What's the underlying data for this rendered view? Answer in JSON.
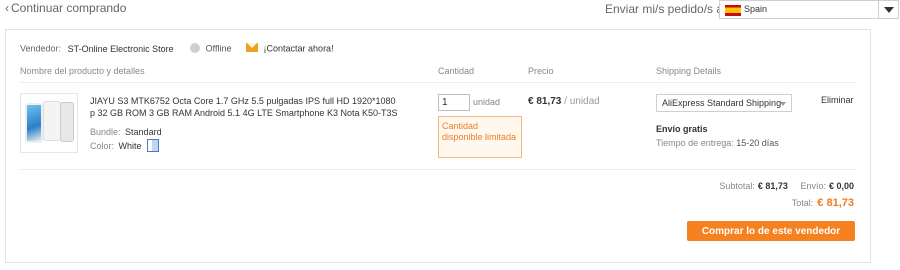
{
  "header": {
    "continue_chevron": "‹",
    "continue_label": "Continuar comprando",
    "ship_to_label": "Enviar mi/s pedido/s a:",
    "country_flag": "ES",
    "country": "Spain"
  },
  "seller": {
    "label": "Vendedor:",
    "name": "ST-Online Electronic Store",
    "status": "Offline",
    "contact_label": "¡Contactar ahora!"
  },
  "columns": {
    "product": "Nombre del producto y detalles",
    "quantity": "Cantidad",
    "price": "Precio",
    "shipping": "Shipping Details"
  },
  "item": {
    "title": "JIAYU S3 MTK6752 Octa Core 1.7 GHz 5.5 pulgadas IPS full HD 1920*1080 p 32 GB ROM 3 GB RAM Android 5.1 4G LTE Smartphone K3 Nota K50-T3S",
    "bundle_label": "Bundle:",
    "bundle_value": "Standard",
    "color_label": "Color:",
    "color_value": "White",
    "quantity": "1",
    "quantity_unit": "unidad",
    "stock_warning": "Cantidad disponible limitada",
    "price": "€ 81,73",
    "price_unit": "/ unidad",
    "shipping_method": "AliExpress Standard Shipping",
    "free_shipping": "Envío gratis",
    "delivery_label": "Tiempo de entrega:",
    "delivery_value": "15-20 días",
    "remove_label": "Eliminar"
  },
  "totals": {
    "subtotal_label": "Subtotal:",
    "subtotal_value": "€ 81,73",
    "shipping_label": "Envío:",
    "shipping_value": "€ 0,00",
    "total_label": "Total:",
    "total_value": "€ 81,73"
  },
  "actions": {
    "buy_label": "Comprar lo de este vendedor"
  },
  "colors": {
    "accent": "#f5821f",
    "total_price": "#f07c22",
    "warning_border": "#f5b981"
  }
}
